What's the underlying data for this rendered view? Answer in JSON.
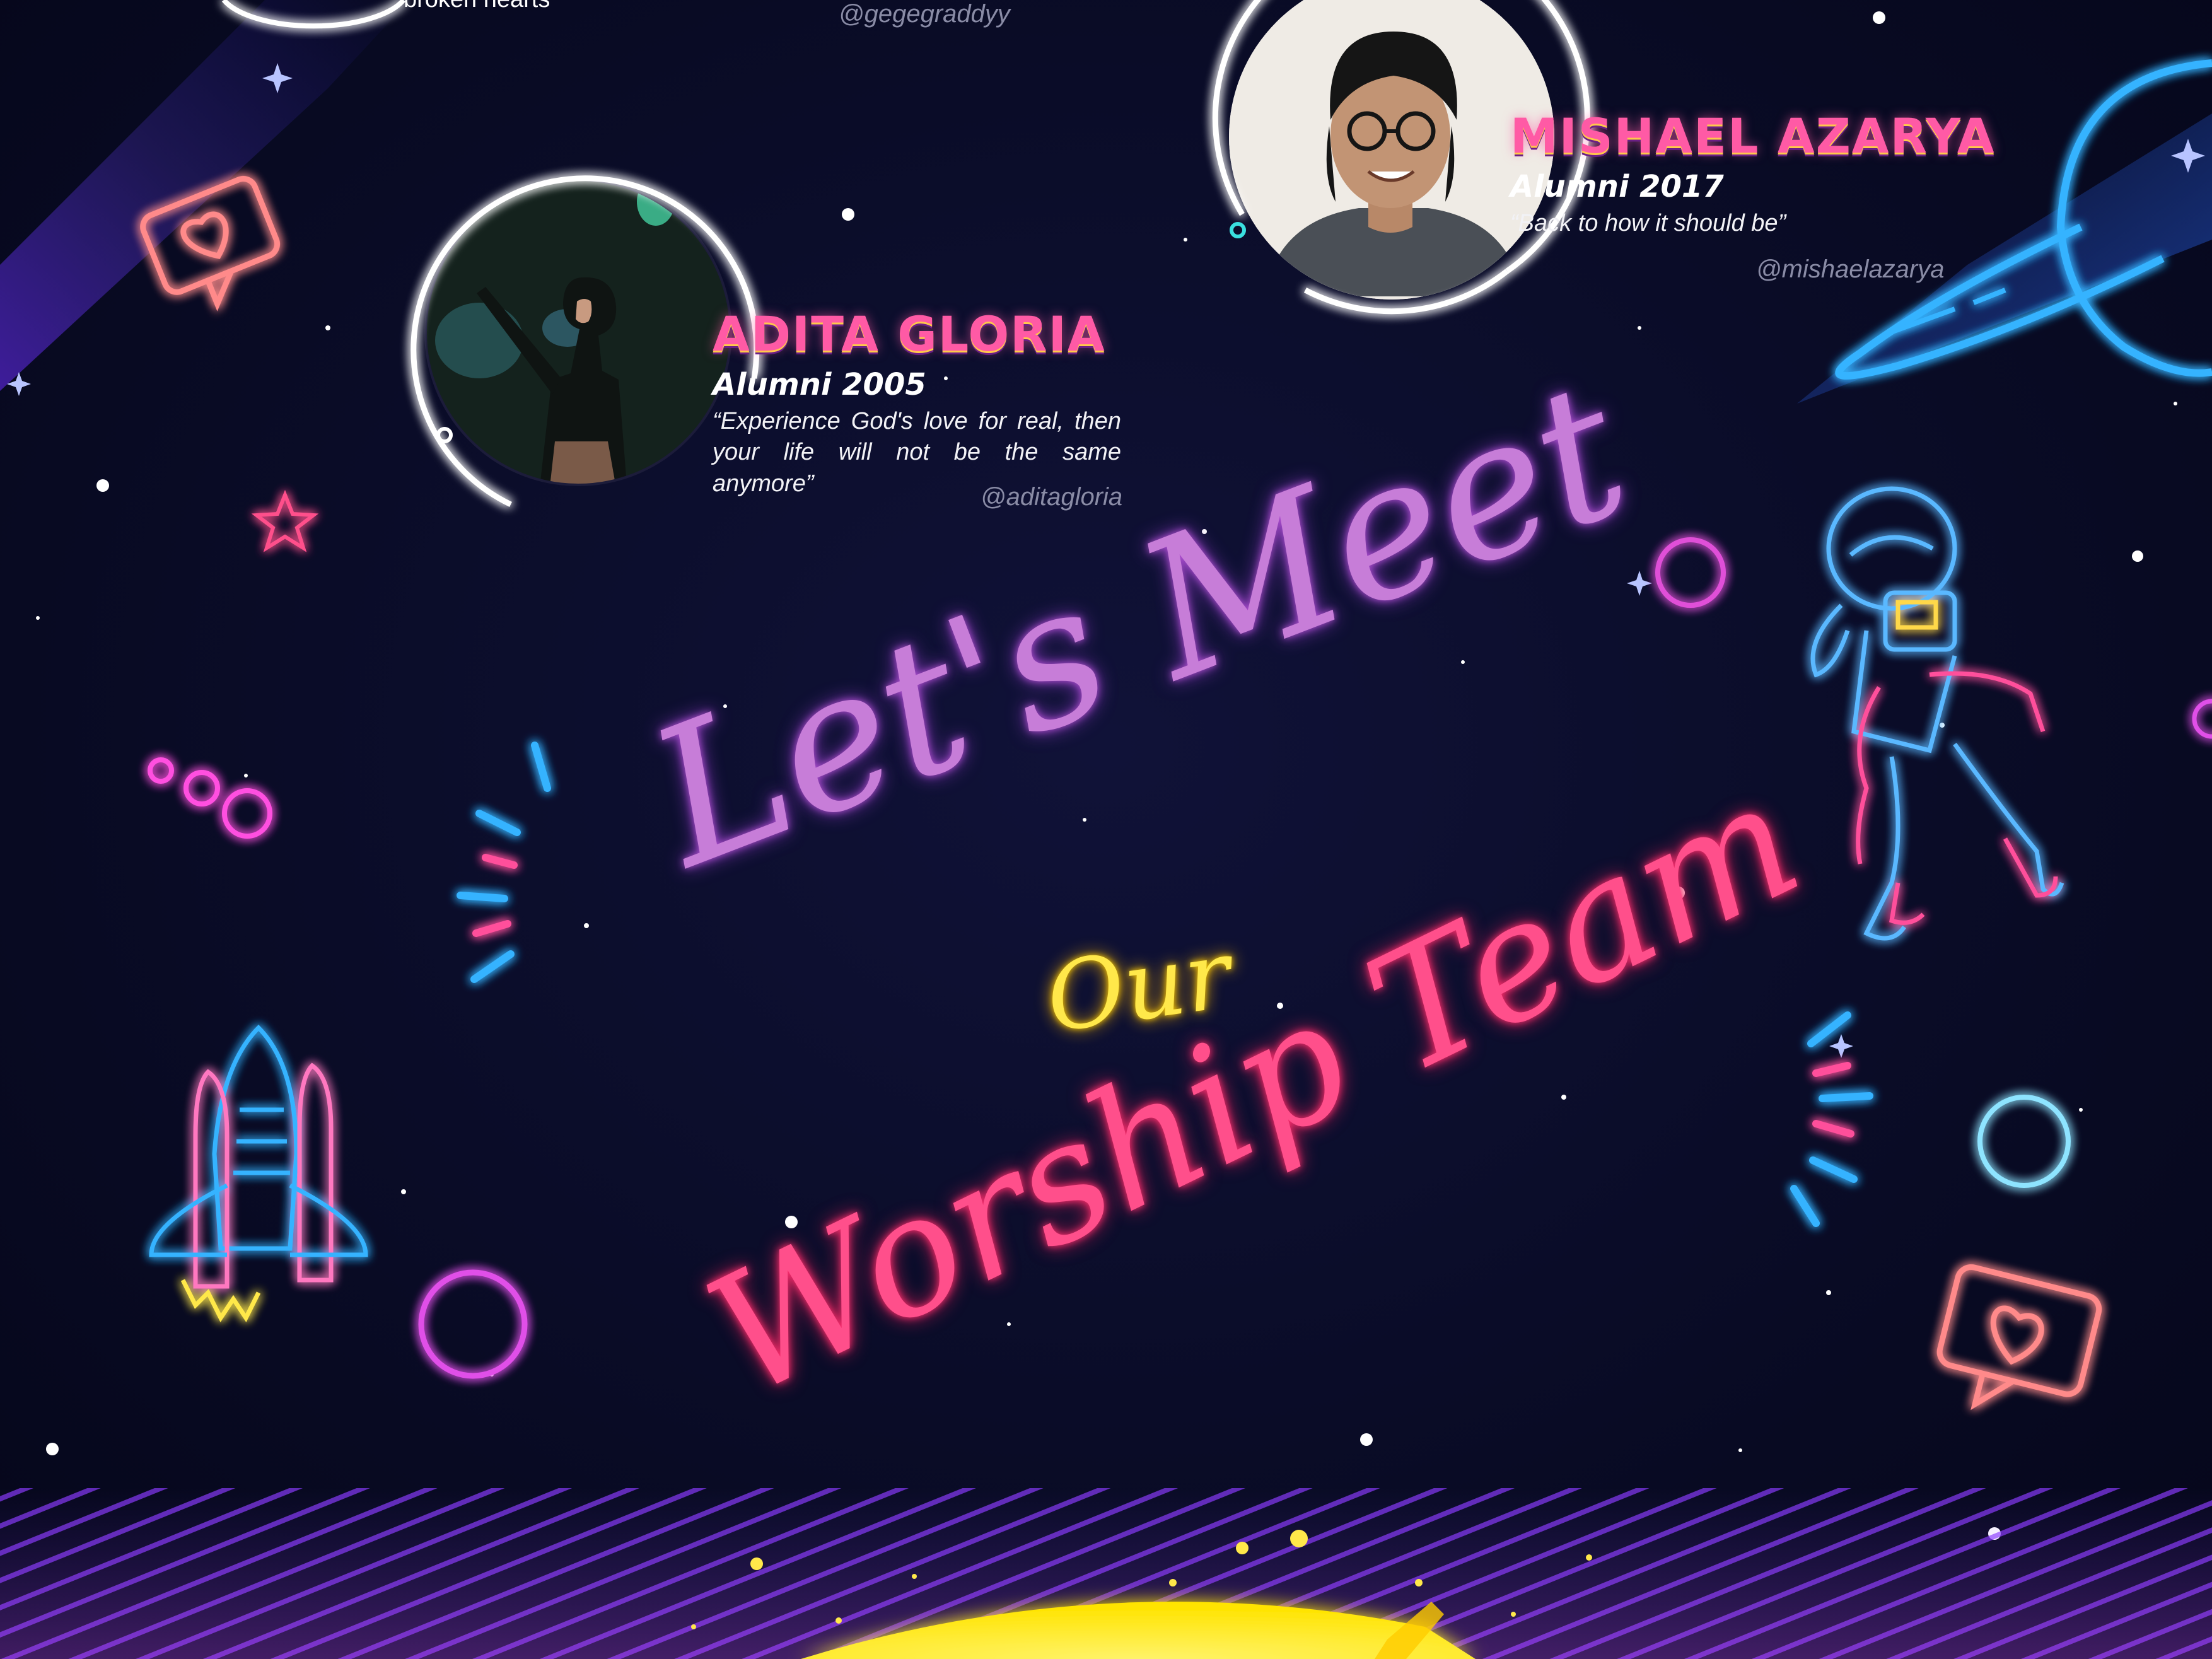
{
  "top": {
    "handle_gege": "@gegegraddyy",
    "cut_text": "broken hearts"
  },
  "mishael": {
    "name": "Mishael Azarya",
    "year": "Alumni 2017",
    "quote": "“Back to how it should be”",
    "handle": "@mishaelazarya"
  },
  "adita": {
    "name": "Adita Gloria",
    "year": "Alumni 2005",
    "quote": "“Experience God's love for real, then your life will not be the same anymore”",
    "handle": "@aditagloria"
  },
  "headline": {
    "line1": "Let's Meet",
    "line2": "Our",
    "line3": "Worship Team"
  },
  "colors": {
    "background": "#0a0b24",
    "neon_pink": "#ff4f8b",
    "neon_violet": "#c77dd8",
    "neon_yellow": "#ffe84a",
    "neon_blue": "#36b3ff",
    "neon_magenta": "#ff4fe0"
  },
  "icons": [
    "heart-chat-icon",
    "star-icon",
    "planet-icon",
    "astronaut-icon",
    "rocket-icon",
    "ring-icon",
    "dots-icon",
    "spark-lines-icon"
  ]
}
